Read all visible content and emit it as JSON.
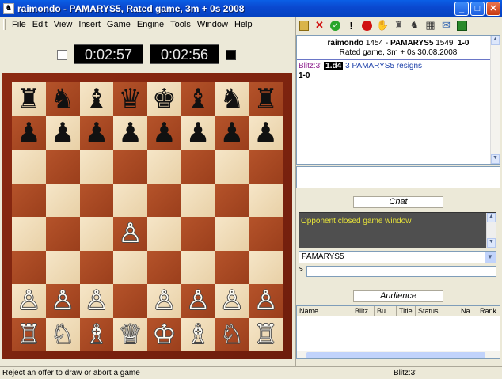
{
  "window": {
    "title": "raimondo - PAMARYS5, Rated game, 3m + 0s 2008"
  },
  "menu": [
    "File",
    "Edit",
    "View",
    "Insert",
    "Game",
    "Engine",
    "Tools",
    "Window",
    "Help"
  ],
  "clocks": {
    "white": "0:02:57",
    "black": "0:02:56"
  },
  "board": {
    "rows": [
      [
        "♜",
        "♞",
        "♝",
        "♛",
        "♚",
        "♝",
        "♞",
        "♜"
      ],
      [
        "♟",
        "♟",
        "♟",
        "♟",
        "♟",
        "♟",
        "♟",
        "♟"
      ],
      [
        "",
        "",
        "",
        "",
        "",
        "",
        "",
        ""
      ],
      [
        "",
        "",
        "",
        "",
        "",
        "",
        "",
        ""
      ],
      [
        "",
        "",
        "",
        "♙",
        "",
        "",
        "",
        ""
      ],
      [
        "",
        "",
        "",
        "",
        "",
        "",
        "",
        ""
      ],
      [
        "♙",
        "♙",
        "♙",
        "",
        "♙",
        "♙",
        "♙",
        "♙"
      ],
      [
        "♖",
        "♘",
        "♗",
        "♕",
        "♔",
        "♗",
        "♘",
        "♖"
      ]
    ],
    "colors": [
      [
        "b",
        "b",
        "b",
        "b",
        "b",
        "b",
        "b",
        "b"
      ],
      [
        "b",
        "b",
        "b",
        "b",
        "b",
        "b",
        "b",
        "b"
      ],
      [
        "",
        "",
        "",
        "",
        "",
        "",
        "",
        ""
      ],
      [
        "",
        "",
        "",
        "",
        "",
        "",
        "",
        ""
      ],
      [
        "",
        "",
        "",
        "w",
        "",
        "",
        "",
        ""
      ],
      [
        "",
        "",
        "",
        "",
        "",
        "",
        "",
        ""
      ],
      [
        "w",
        "w",
        "w",
        "",
        "w",
        "w",
        "w",
        "w"
      ],
      [
        "w",
        "w",
        "w",
        "w",
        "w",
        "w",
        "w",
        "w"
      ]
    ]
  },
  "toolbar_icons": [
    "clipboard-icon",
    "cross-icon",
    "check-icon",
    "exclamation-icon",
    "stop-icon",
    "handshake-icon",
    "rocket-icon",
    "pieces-icon",
    "board-icon",
    "chat-icon",
    "engine-icon"
  ],
  "game": {
    "white_player": "raimondo",
    "white_rating": "1454",
    "black_player": "PAMARYS5",
    "black_rating": "1549",
    "result": "1-0",
    "subtitle": "Rated game, 3m + 0s 30.08.2008",
    "event": "Blitz:3'",
    "move_label": "1.d4",
    "move_comment": "3 PAMARYS5 resigns",
    "final_result": "1-0"
  },
  "chat": {
    "tab_label": "Chat",
    "message": "Opponent closed game window",
    "recipient": "PAMARYS5",
    "prompt": ">"
  },
  "audience": {
    "tab_label": "Audience",
    "columns": [
      "Name",
      "Blitz",
      "Bu...",
      "Title",
      "Status",
      "Na...",
      "Rank"
    ]
  },
  "status": {
    "message": "Reject an offer to draw or abort a game",
    "mode": "Blitz:3'"
  }
}
